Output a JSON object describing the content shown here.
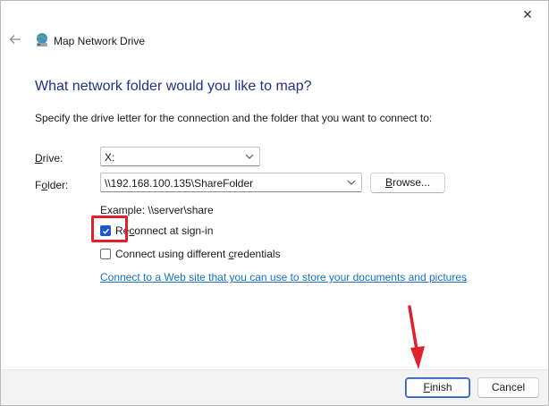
{
  "window": {
    "title": "Map Network Drive",
    "close_glyph": "✕"
  },
  "wizard": {
    "heading": "What network folder would you like to map?",
    "instructions": "Specify the drive letter for the connection and the folder that you want to connect to:"
  },
  "form": {
    "drive_label_key": "D",
    "drive_label_rest": "rive:",
    "drive_value": "X:",
    "folder_label_key": "o",
    "folder_label_start": "F",
    "folder_label_rest": "lder:",
    "folder_value": "\\\\192.168.100.135\\ShareFolder",
    "browse_key": "B",
    "browse_rest": "rowse...",
    "example": "Example: \\\\server\\share",
    "reconnect_start": "Re",
    "reconnect_key": "c",
    "reconnect_rest": "onnect at sign-in",
    "reconnect_checked": true,
    "credentials_start": "Connect using different ",
    "credentials_key": "c",
    "credentials_rest": "redentials",
    "credentials_checked": false,
    "link_text": "Connect to a Web site that you can use to store your documents and pictures",
    "link_suffix": "."
  },
  "footer": {
    "finish_key": "F",
    "finish_rest": "inish",
    "cancel_label": "Cancel"
  },
  "colors": {
    "heading": "#1e3287",
    "link": "#1a6fbf",
    "checkbox_checked": "#1d5ac8",
    "annotation_red": "#e0202a"
  },
  "icons": {
    "back": "back-arrow-icon",
    "app": "network-drive-icon",
    "close": "close-icon",
    "dropdown": "chevron-down-icon",
    "check": "checkmark-icon"
  }
}
